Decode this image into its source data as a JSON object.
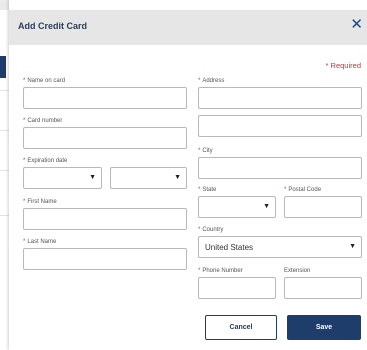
{
  "modal": {
    "title": "Add Credit Card",
    "close_symbol": "✕",
    "required_note": "* Required"
  },
  "fields": {
    "name_on_card": {
      "label": "Name on card",
      "value": ""
    },
    "card_number": {
      "label": "Card number",
      "value": ""
    },
    "expiration_date": {
      "label": "Expiration date",
      "month": "",
      "year": ""
    },
    "first_name": {
      "label": "First Name",
      "value": ""
    },
    "last_name": {
      "label": "Last Name",
      "value": ""
    },
    "address": {
      "label": "Address",
      "line1": "",
      "line2": ""
    },
    "city": {
      "label": "City",
      "value": ""
    },
    "state": {
      "label": "State",
      "value": ""
    },
    "postal_code": {
      "label": "Postal Code",
      "value": ""
    },
    "country": {
      "label": "Country",
      "value": "United States"
    },
    "phone_number": {
      "label": "Phone Number",
      "value": ""
    },
    "extension": {
      "label": "Extension",
      "value": ""
    }
  },
  "buttons": {
    "cancel_label": "Cancel",
    "save_label": "Save"
  },
  "icons": {
    "close": "close-icon",
    "dropdown": "chevron-down-icon"
  },
  "colors": {
    "primary": "#1f3d6b",
    "required": "#c0392b",
    "header_bg": "#e6e6e6"
  }
}
